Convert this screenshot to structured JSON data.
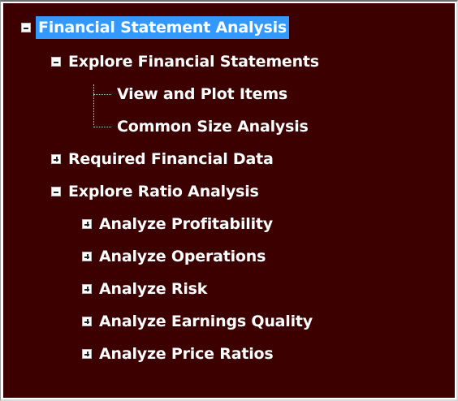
{
  "tree": {
    "root": {
      "label": "Financial Statement Analysis",
      "expanded": true,
      "selected": true
    },
    "items": [
      {
        "label": "Explore Financial Statements",
        "expanded": true
      },
      {
        "label": "View and Plot Items"
      },
      {
        "label": "Common Size Analysis"
      },
      {
        "label": "Required Financial Data",
        "expanded": false
      },
      {
        "label": "Explore Ratio Analysis",
        "expanded": true
      },
      {
        "label": "Analyze Profitability",
        "expanded": false
      },
      {
        "label": "Analyze Operations",
        "expanded": false
      },
      {
        "label": "Analyze Risk",
        "expanded": false
      },
      {
        "label": "Analyze Earnings Quality",
        "expanded": false
      },
      {
        "label": "Analyze Price Ratios",
        "expanded": false
      }
    ]
  },
  "colors": {
    "background": "#3c0000",
    "selection": "#3399ff",
    "text": "#ffffff"
  }
}
